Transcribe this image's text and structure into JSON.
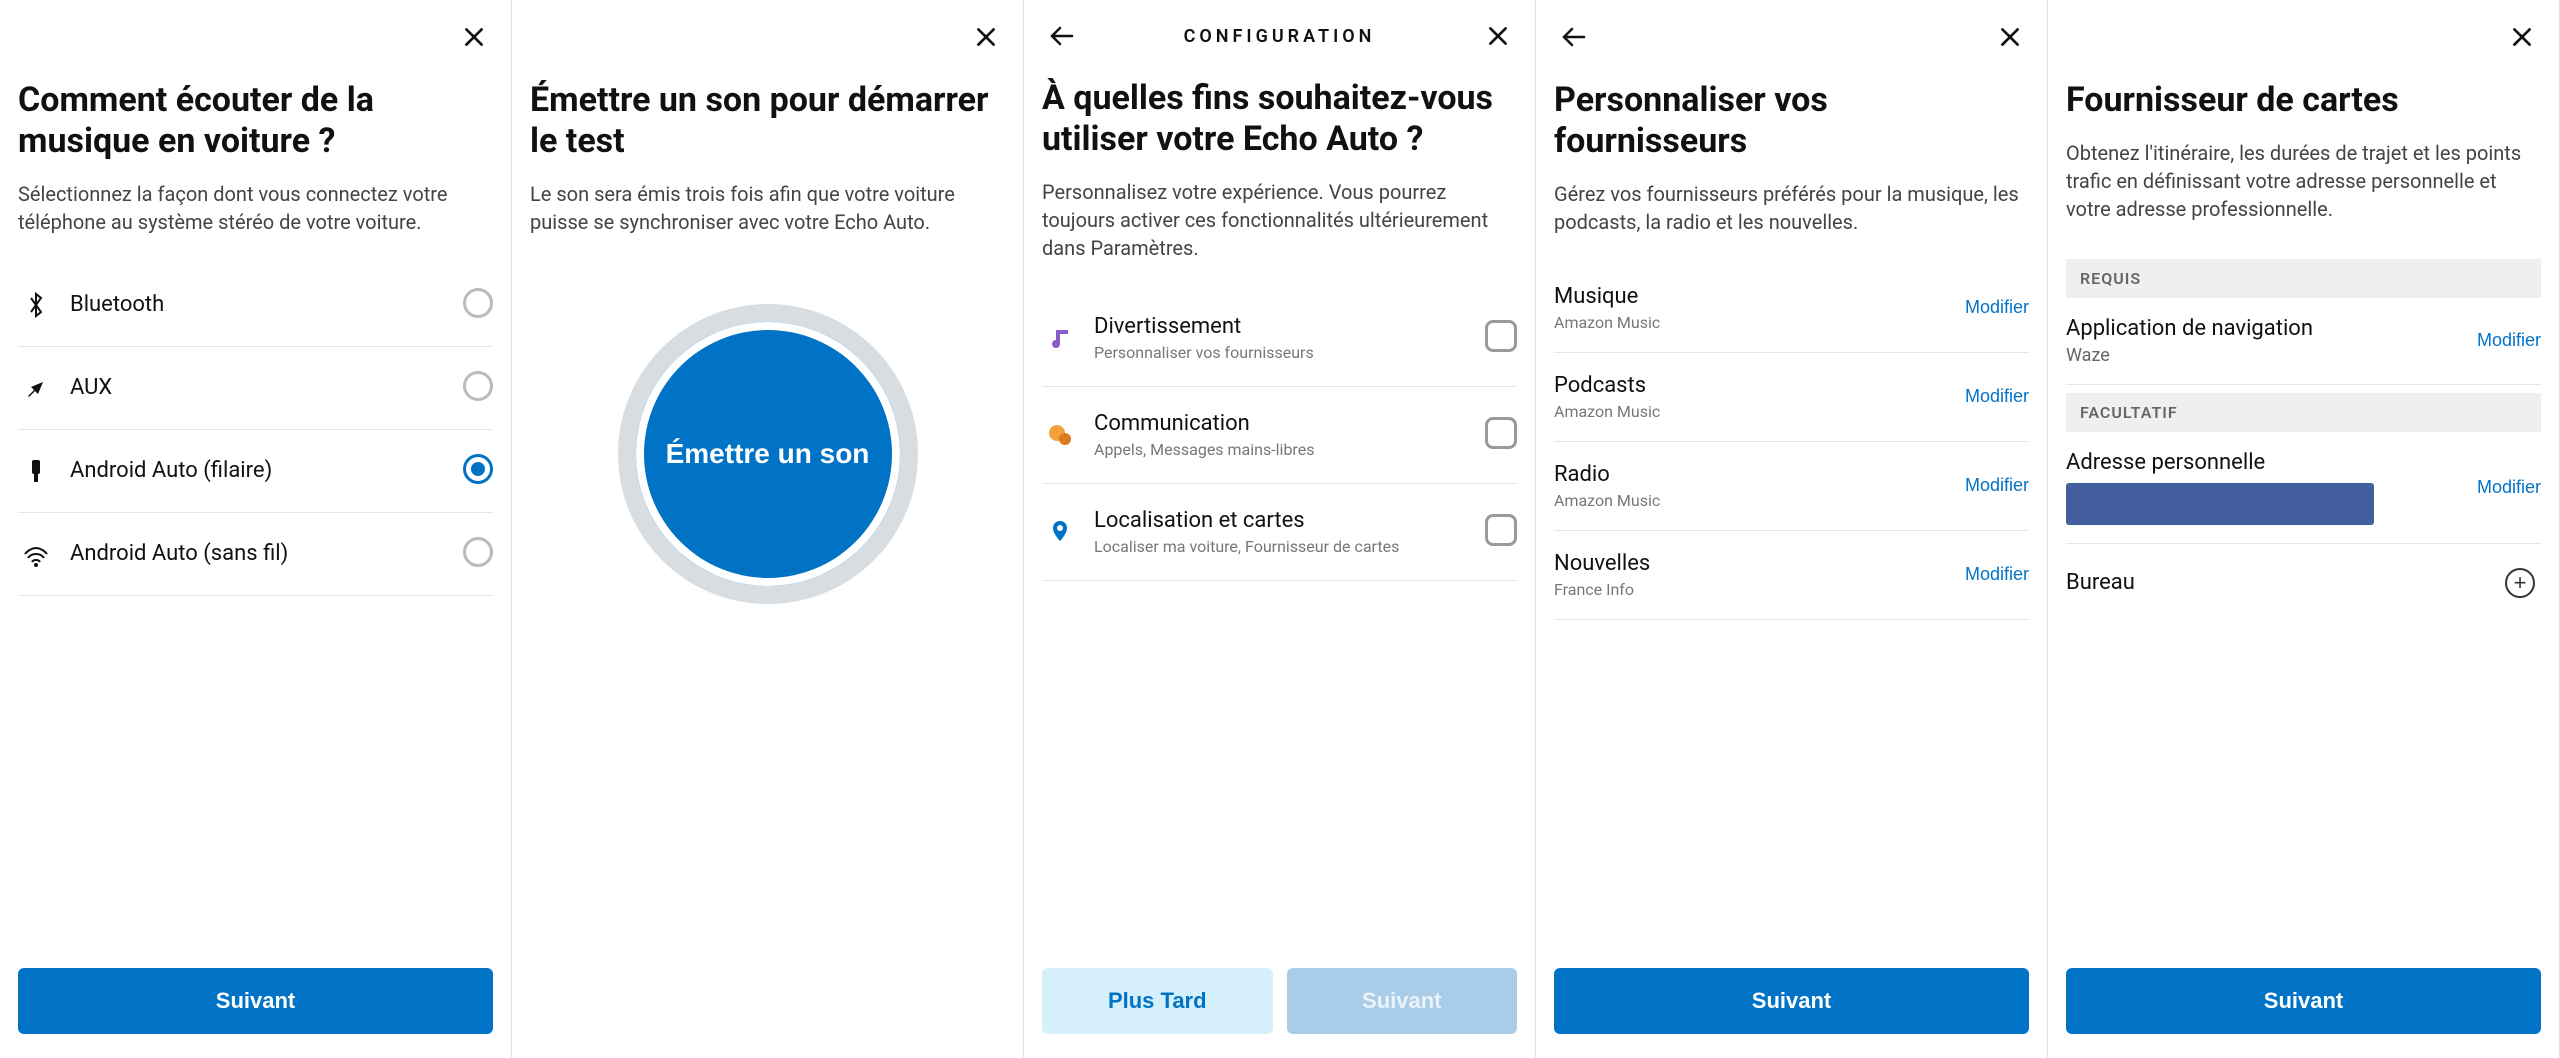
{
  "colors": {
    "primary": "#0073c6",
    "link": "#0073c6"
  },
  "common": {
    "close": "×",
    "back": "←",
    "next": "Suivant",
    "later": "Plus Tard",
    "edit": "Modifier"
  },
  "p1": {
    "title": "Comment écouter de la musique en voiture ?",
    "subtitle": "Sélectionnez la façon dont vous connectez votre téléphone au système stéréo de votre voiture.",
    "options": [
      {
        "label": "Bluetooth",
        "icon": "bluetooth-icon",
        "selected": false
      },
      {
        "label": "AUX",
        "icon": "aux-icon",
        "selected": false
      },
      {
        "label": "Android Auto (filaire)",
        "icon": "android-auto-wired-icon",
        "selected": true
      },
      {
        "label": "Android Auto (sans fil)",
        "icon": "android-auto-wireless-icon",
        "selected": false
      }
    ]
  },
  "p2": {
    "title": "Émettre un son pour démarrer le test",
    "subtitle": "Le son sera émis trois fois afin que votre voiture puisse se synchroniser avec votre Echo Auto.",
    "button": "Émettre un son"
  },
  "p3": {
    "header": "CONFIGURATION",
    "title": "À quelles fins souhaitez-vous utiliser votre Echo Auto ?",
    "subtitle": "Personnalisez votre expérience. Vous pourrez toujours activer ces fonctionnalités ultérieurement dans Paramètres.",
    "items": [
      {
        "title": "Divertissement",
        "sub": "Personnaliser vos fournisseurs",
        "icon": "music-note-icon"
      },
      {
        "title": "Communication",
        "sub": "Appels, Messages mains-libres",
        "icon": "chat-bubbles-icon"
      },
      {
        "title": "Localisation et cartes",
        "sub": "Localiser ma voiture, Fournisseur de cartes",
        "icon": "location-pin-icon"
      }
    ]
  },
  "p4": {
    "title": "Personnaliser vos fournisseurs",
    "subtitle": "Gérez vos fournisseurs préférés pour la musique, les podcasts, la radio et les nouvelles.",
    "items": [
      {
        "title": "Musique",
        "sub": "Amazon Music"
      },
      {
        "title": "Podcasts",
        "sub": "Amazon Music"
      },
      {
        "title": "Radio",
        "sub": "Amazon Music"
      },
      {
        "title": "Nouvelles",
        "sub": "France Info"
      }
    ]
  },
  "p5": {
    "title": "Fournisseur de cartes",
    "subtitle": "Obtenez l'itinéraire, les durées de trajet et les points trafic en définissant votre adresse personnelle et votre adresse professionnelle.",
    "required_label": "REQUIS",
    "optional_label": "FACULTATIF",
    "nav_app": {
      "title": "Application de navigation",
      "value": "Waze"
    },
    "home": {
      "title": "Adresse personnelle"
    },
    "office": {
      "title": "Bureau"
    }
  }
}
